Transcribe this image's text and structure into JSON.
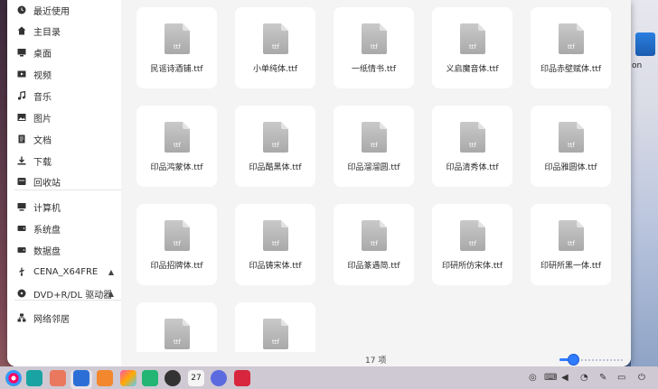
{
  "sidebar": {
    "items": [
      {
        "label": "最近使用",
        "icon": "clock-icon"
      },
      {
        "label": "主目录",
        "icon": "home-icon"
      },
      {
        "label": "桌面",
        "icon": "desktop-icon"
      },
      {
        "label": "视频",
        "icon": "video-icon"
      },
      {
        "label": "音乐",
        "icon": "music-icon"
      },
      {
        "label": "图片",
        "icon": "picture-icon"
      },
      {
        "label": "文档",
        "icon": "document-icon"
      },
      {
        "label": "下载",
        "icon": "download-icon"
      },
      {
        "label": "回收站",
        "icon": "trash-icon"
      },
      {
        "label": "计算机",
        "icon": "computer-icon"
      },
      {
        "label": "系统盘",
        "icon": "disk-icon"
      },
      {
        "label": "数据盘",
        "icon": "disk-icon"
      },
      {
        "label": "CENA_X64FRE",
        "icon": "usb-icon",
        "eject": "▲"
      },
      {
        "label": "DVD+R/DL 驱动器",
        "icon": "disc-icon",
        "eject": "▲"
      },
      {
        "label": "网络邻居",
        "icon": "network-icon"
      }
    ]
  },
  "files": [
    {
      "name": "民谣诗酒铺.ttf",
      "ext": "ttf"
    },
    {
      "name": "小单纯体.ttf",
      "ext": "ttf"
    },
    {
      "name": "一纸情书.ttf",
      "ext": "ttf"
    },
    {
      "name": "义启魔音体.ttf",
      "ext": "ttf"
    },
    {
      "name": "印品赤壁赋体.ttf",
      "ext": "ttf"
    },
    {
      "name": "印品鸿蒙体.ttf",
      "ext": "ttf"
    },
    {
      "name": "印品酷黑体.ttf",
      "ext": "ttf"
    },
    {
      "name": "印品溜溜圆.ttf",
      "ext": "ttf"
    },
    {
      "name": "印品清秀体.ttf",
      "ext": "ttf"
    },
    {
      "name": "印品雅圆体.ttf",
      "ext": "ttf"
    },
    {
      "name": "印品招牌体.ttf",
      "ext": "ttf"
    },
    {
      "name": "印品铸宋体.ttf",
      "ext": "ttf"
    },
    {
      "name": "印品篆遇简.ttf",
      "ext": "ttf"
    },
    {
      "name": "印研所仿宋体.ttf",
      "ext": "ttf"
    },
    {
      "name": "印研所黑一体.ttf",
      "ext": "ttf"
    },
    {
      "name": "",
      "ext": "ttf"
    },
    {
      "name": "",
      "ext": "ttf"
    }
  ],
  "status": {
    "count": "17 项",
    "zoom_level": 0.2
  },
  "desktop": {
    "icon_label": "on"
  },
  "taskbar": {
    "apps": [
      "launcher-icon",
      "multitask-icon",
      "app-store-icon",
      "file-manager-icon",
      "store-icon",
      "photos-icon",
      "music-icon",
      "video-player-icon",
      "calendar-icon",
      "settings-icon",
      "terminal-icon"
    ],
    "calendar_day": "27"
  }
}
